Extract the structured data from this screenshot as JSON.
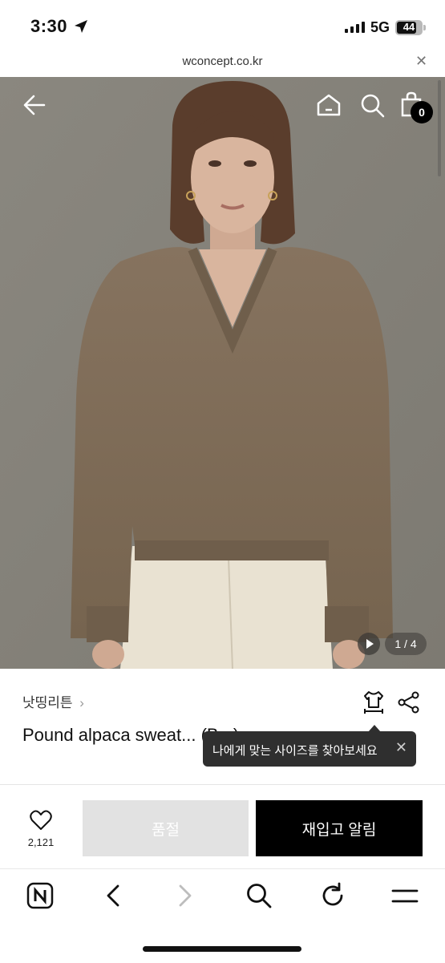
{
  "status_bar": {
    "time": "3:30",
    "network": "5G",
    "battery": "44"
  },
  "browser": {
    "url": "wconcept.co.kr"
  },
  "header": {
    "cart_count": "0"
  },
  "gallery": {
    "pager": "1 / 4"
  },
  "product": {
    "brand": "낫띵리튼",
    "title": "Pound alpaca sweat... (B...)",
    "size_tooltip": "나에게 맞는 사이즈를 찾아보세요"
  },
  "actions": {
    "like_count": "2,121",
    "soldout_label": "품절",
    "restock_label": "재입고 알림"
  },
  "colors": {
    "sweater": "#7e6c5a",
    "background": "#8d8a82",
    "button_primary": "#000000",
    "button_disabled": "#e2e2e2"
  }
}
